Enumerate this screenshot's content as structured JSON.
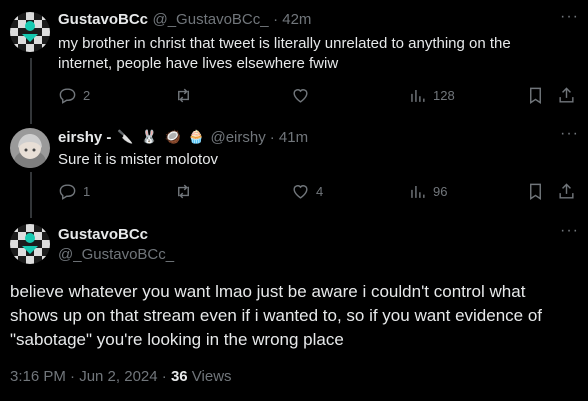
{
  "tweets": [
    {
      "display_name": "GustavoBCc",
      "handle": "@_GustavoBCc_",
      "time": "· 42m",
      "text_line1": "my brother in christ that tweet is literally unrelated to anything on the",
      "text_line2": "internet, people have lives elsewhere fwiw",
      "replies": "2",
      "retweets": "",
      "likes": "",
      "views": "128"
    },
    {
      "display_name": "eirshy -",
      "handle": "@eirshy",
      "time": "· 41m",
      "name_emojis": [
        "🔪",
        "🐰",
        "🥥",
        "🧁"
      ],
      "text_line1": "Sure it is mister molotov",
      "replies": "1",
      "retweets": "",
      "likes": "4",
      "views": "96"
    }
  ],
  "main_tweet": {
    "display_name": "GustavoBCc",
    "handle": "@_GustavoBCc_",
    "text_line1": "believe whatever you want lmao just be aware i couldn't control what",
    "text_line2": "shows up on that stream even if i wanted to, so if you want evidence of",
    "text_line3": "\"sabotage\" you're looking in the wrong place",
    "timestamp": "3:16 PM · Jun 2, 2024 ·",
    "views_count": "36",
    "views_label": "Views"
  },
  "icons": {
    "more": "more-dots-icon",
    "reply": "reply-bubble-icon",
    "retweet": "retweet-arrows-icon",
    "like": "heart-icon",
    "views": "bar-chart-icon",
    "bookmark": "bookmark-icon",
    "share": "share-upload-icon"
  },
  "colors": {
    "background": "#000000",
    "text": "#e7e9ea",
    "muted": "#71767b",
    "thread_line": "#333639"
  }
}
